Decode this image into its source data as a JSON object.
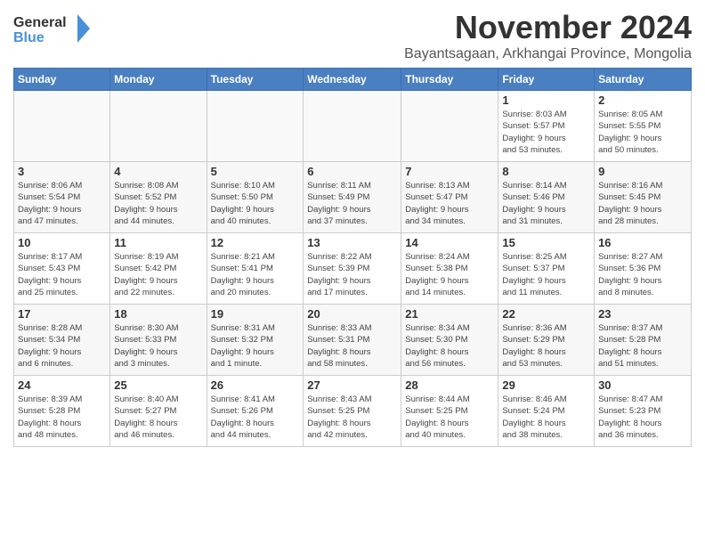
{
  "header": {
    "logo_line1": "General",
    "logo_line2": "Blue",
    "month_title": "November 2024",
    "location": "Bayantsagaan, Arkhangai Province, Mongolia"
  },
  "weekdays": [
    "Sunday",
    "Monday",
    "Tuesday",
    "Wednesday",
    "Thursday",
    "Friday",
    "Saturday"
  ],
  "weeks": [
    [
      {
        "day": "",
        "info": ""
      },
      {
        "day": "",
        "info": ""
      },
      {
        "day": "",
        "info": ""
      },
      {
        "day": "",
        "info": ""
      },
      {
        "day": "",
        "info": ""
      },
      {
        "day": "1",
        "info": "Sunrise: 8:03 AM\nSunset: 5:57 PM\nDaylight: 9 hours\nand 53 minutes."
      },
      {
        "day": "2",
        "info": "Sunrise: 8:05 AM\nSunset: 5:55 PM\nDaylight: 9 hours\nand 50 minutes."
      }
    ],
    [
      {
        "day": "3",
        "info": "Sunrise: 8:06 AM\nSunset: 5:54 PM\nDaylight: 9 hours\nand 47 minutes."
      },
      {
        "day": "4",
        "info": "Sunrise: 8:08 AM\nSunset: 5:52 PM\nDaylight: 9 hours\nand 44 minutes."
      },
      {
        "day": "5",
        "info": "Sunrise: 8:10 AM\nSunset: 5:50 PM\nDaylight: 9 hours\nand 40 minutes."
      },
      {
        "day": "6",
        "info": "Sunrise: 8:11 AM\nSunset: 5:49 PM\nDaylight: 9 hours\nand 37 minutes."
      },
      {
        "day": "7",
        "info": "Sunrise: 8:13 AM\nSunset: 5:47 PM\nDaylight: 9 hours\nand 34 minutes."
      },
      {
        "day": "8",
        "info": "Sunrise: 8:14 AM\nSunset: 5:46 PM\nDaylight: 9 hours\nand 31 minutes."
      },
      {
        "day": "9",
        "info": "Sunrise: 8:16 AM\nSunset: 5:45 PM\nDaylight: 9 hours\nand 28 minutes."
      }
    ],
    [
      {
        "day": "10",
        "info": "Sunrise: 8:17 AM\nSunset: 5:43 PM\nDaylight: 9 hours\nand 25 minutes."
      },
      {
        "day": "11",
        "info": "Sunrise: 8:19 AM\nSunset: 5:42 PM\nDaylight: 9 hours\nand 22 minutes."
      },
      {
        "day": "12",
        "info": "Sunrise: 8:21 AM\nSunset: 5:41 PM\nDaylight: 9 hours\nand 20 minutes."
      },
      {
        "day": "13",
        "info": "Sunrise: 8:22 AM\nSunset: 5:39 PM\nDaylight: 9 hours\nand 17 minutes."
      },
      {
        "day": "14",
        "info": "Sunrise: 8:24 AM\nSunset: 5:38 PM\nDaylight: 9 hours\nand 14 minutes."
      },
      {
        "day": "15",
        "info": "Sunrise: 8:25 AM\nSunset: 5:37 PM\nDaylight: 9 hours\nand 11 minutes."
      },
      {
        "day": "16",
        "info": "Sunrise: 8:27 AM\nSunset: 5:36 PM\nDaylight: 9 hours\nand 8 minutes."
      }
    ],
    [
      {
        "day": "17",
        "info": "Sunrise: 8:28 AM\nSunset: 5:34 PM\nDaylight: 9 hours\nand 6 minutes."
      },
      {
        "day": "18",
        "info": "Sunrise: 8:30 AM\nSunset: 5:33 PM\nDaylight: 9 hours\nand 3 minutes."
      },
      {
        "day": "19",
        "info": "Sunrise: 8:31 AM\nSunset: 5:32 PM\nDaylight: 9 hours\nand 1 minute."
      },
      {
        "day": "20",
        "info": "Sunrise: 8:33 AM\nSunset: 5:31 PM\nDaylight: 8 hours\nand 58 minutes."
      },
      {
        "day": "21",
        "info": "Sunrise: 8:34 AM\nSunset: 5:30 PM\nDaylight: 8 hours\nand 56 minutes."
      },
      {
        "day": "22",
        "info": "Sunrise: 8:36 AM\nSunset: 5:29 PM\nDaylight: 8 hours\nand 53 minutes."
      },
      {
        "day": "23",
        "info": "Sunrise: 8:37 AM\nSunset: 5:28 PM\nDaylight: 8 hours\nand 51 minutes."
      }
    ],
    [
      {
        "day": "24",
        "info": "Sunrise: 8:39 AM\nSunset: 5:28 PM\nDaylight: 8 hours\nand 48 minutes."
      },
      {
        "day": "25",
        "info": "Sunrise: 8:40 AM\nSunset: 5:27 PM\nDaylight: 8 hours\nand 46 minutes."
      },
      {
        "day": "26",
        "info": "Sunrise: 8:41 AM\nSunset: 5:26 PM\nDaylight: 8 hours\nand 44 minutes."
      },
      {
        "day": "27",
        "info": "Sunrise: 8:43 AM\nSunset: 5:25 PM\nDaylight: 8 hours\nand 42 minutes."
      },
      {
        "day": "28",
        "info": "Sunrise: 8:44 AM\nSunset: 5:25 PM\nDaylight: 8 hours\nand 40 minutes."
      },
      {
        "day": "29",
        "info": "Sunrise: 8:46 AM\nSunset: 5:24 PM\nDaylight: 8 hours\nand 38 minutes."
      },
      {
        "day": "30",
        "info": "Sunrise: 8:47 AM\nSunset: 5:23 PM\nDaylight: 8 hours\nand 36 minutes."
      }
    ]
  ]
}
